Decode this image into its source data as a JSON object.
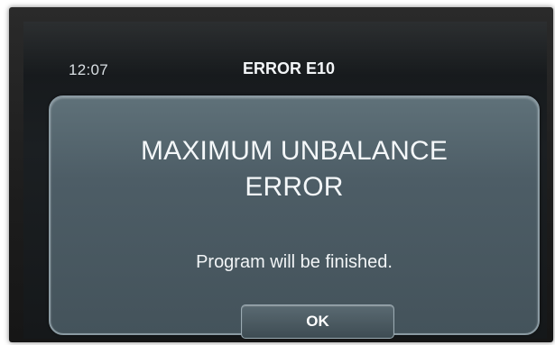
{
  "status_bar": {
    "time": "12:07",
    "error_code": "ERROR E10"
  },
  "dialog": {
    "title_line1": "MAXIMUM UNBALANCE",
    "title_line2": "ERROR",
    "message": "Program will be finished.",
    "ok_label": "OK"
  },
  "colors": {
    "screen_background": "#16191b",
    "dialog_background": "#4d5d66",
    "dialog_border": "#8a9aa2",
    "text": "#f4f7f9"
  }
}
